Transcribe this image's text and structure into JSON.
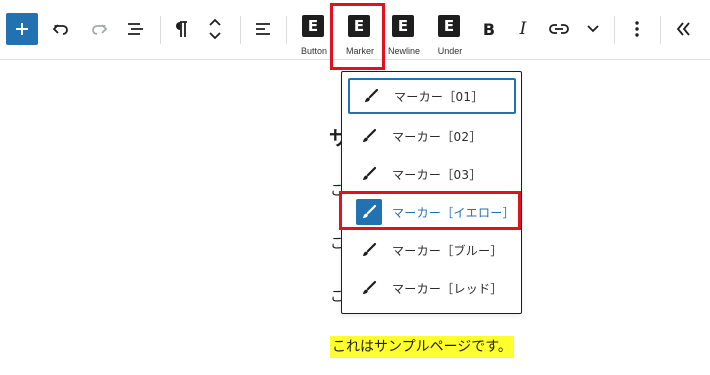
{
  "toolbar": {
    "buttons": [
      {
        "name": "add-block",
        "icon": "plus-icon"
      },
      {
        "name": "undo",
        "icon": "undo-icon"
      },
      {
        "name": "redo",
        "icon": "redo-icon"
      },
      {
        "name": "document-overview",
        "icon": "list-view-icon"
      },
      {
        "name": "paragraph",
        "icon": "pilcrow-icon"
      },
      {
        "name": "move",
        "icon": "chevron-up-down-icon"
      },
      {
        "name": "align",
        "icon": "align-left-icon"
      }
    ],
    "custom_buttons": [
      {
        "glyph": "E",
        "label": "Button"
      },
      {
        "glyph": "E",
        "label": "Marker"
      },
      {
        "glyph": "E",
        "label": "Newline"
      },
      {
        "glyph": "E",
        "label": "Under"
      }
    ],
    "bold_label": "B",
    "italic_label": "I",
    "accent_color": "#2271b1"
  },
  "dropdown": {
    "options": [
      {
        "label": "マーカー［01］",
        "state": "focused"
      },
      {
        "label": "マーカー［02］",
        "state": "normal"
      },
      {
        "label": "マーカー［03］",
        "state": "normal"
      },
      {
        "label": "マーカー［イエロー］",
        "state": "active"
      },
      {
        "label": "マーカー［ブルー］",
        "state": "normal"
      },
      {
        "label": "マーカー［レッド］",
        "state": "normal"
      }
    ]
  },
  "content": {
    "heading_partial": "サ",
    "paragraph_partials": [
      "こ",
      "こ",
      "こ"
    ],
    "marked_text": "これはサンプルページです。",
    "marker_color": "#ffff2e"
  },
  "highlight_color": "#e0121f"
}
